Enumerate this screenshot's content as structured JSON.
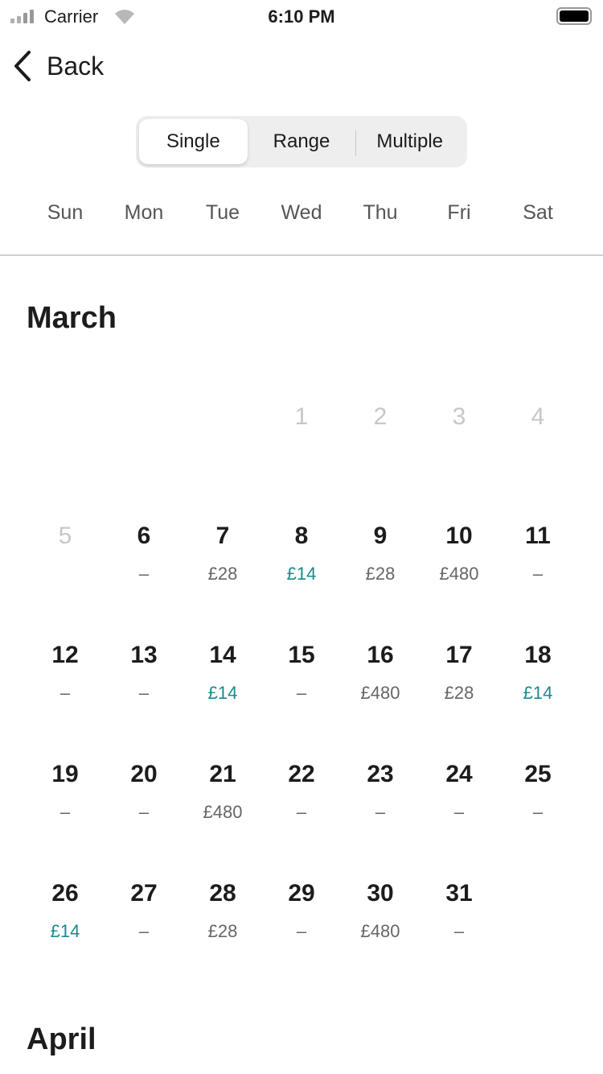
{
  "status_bar": {
    "carrier": "Carrier",
    "time": "6:10 PM"
  },
  "nav": {
    "back_label": "Back"
  },
  "mode_selector": {
    "options": [
      "Single",
      "Range",
      "Multiple"
    ],
    "selected": "Single"
  },
  "weekdays": [
    "Sun",
    "Mon",
    "Tue",
    "Wed",
    "Thu",
    "Fri",
    "Sat"
  ],
  "colors": {
    "cheap_price": "#1a8a8a",
    "price": "#666666"
  },
  "months": [
    {
      "name": "March",
      "first_weekday": 3,
      "days": [
        {
          "day": "1",
          "disabled": true,
          "price": ""
        },
        {
          "day": "2",
          "disabled": true,
          "price": ""
        },
        {
          "day": "3",
          "disabled": true,
          "price": ""
        },
        {
          "day": "4",
          "disabled": true,
          "price": ""
        },
        {
          "day": "5",
          "disabled": true,
          "price": ""
        },
        {
          "day": "6",
          "price": "–"
        },
        {
          "day": "7",
          "price": "£28"
        },
        {
          "day": "8",
          "price": "£14",
          "cheap": true
        },
        {
          "day": "9",
          "price": "£28"
        },
        {
          "day": "10",
          "price": "£480"
        },
        {
          "day": "11",
          "price": "–"
        },
        {
          "day": "12",
          "price": "–"
        },
        {
          "day": "13",
          "price": "–"
        },
        {
          "day": "14",
          "price": "£14",
          "cheap": true
        },
        {
          "day": "15",
          "price": "–"
        },
        {
          "day": "16",
          "price": "£480"
        },
        {
          "day": "17",
          "price": "£28"
        },
        {
          "day": "18",
          "price": "£14",
          "cheap": true
        },
        {
          "day": "19",
          "price": "–"
        },
        {
          "day": "20",
          "price": "–"
        },
        {
          "day": "21",
          "price": "£480"
        },
        {
          "day": "22",
          "price": "–"
        },
        {
          "day": "23",
          "price": "–"
        },
        {
          "day": "24",
          "price": "–"
        },
        {
          "day": "25",
          "price": "–"
        },
        {
          "day": "26",
          "price": "£14",
          "cheap": true
        },
        {
          "day": "27",
          "price": "–"
        },
        {
          "day": "28",
          "price": "£28"
        },
        {
          "day": "29",
          "price": "–"
        },
        {
          "day": "30",
          "price": "£480"
        },
        {
          "day": "31",
          "price": "–"
        }
      ]
    },
    {
      "name": "April"
    }
  ]
}
